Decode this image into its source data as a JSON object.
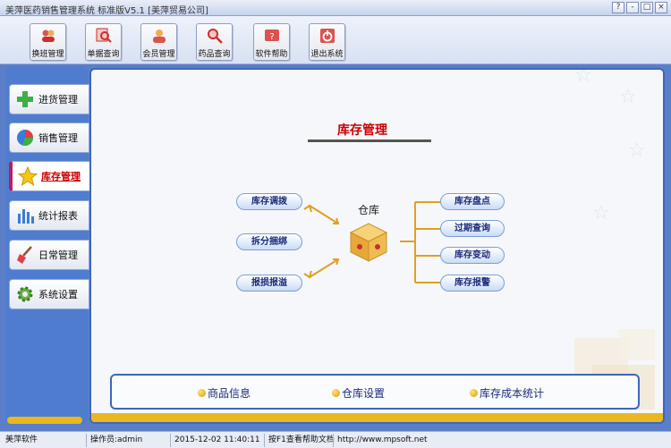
{
  "window": {
    "title": "美萍医药销售管理系统 标准版V5.1 [美萍贸易公司]",
    "controls": [
      "?",
      "-",
      "□",
      "×"
    ]
  },
  "toolbar": {
    "buttons": [
      {
        "label": "换班管理",
        "icon": "users-icon",
        "color": "#d9534f"
      },
      {
        "label": "单据查询",
        "icon": "magnifier-icon",
        "color": "#d9534f"
      },
      {
        "label": "会员管理",
        "icon": "member-icon",
        "color": "#d9534f"
      },
      {
        "label": "药品查询",
        "icon": "search-drug-icon",
        "color": "#d9534f"
      },
      {
        "label": "软件帮助",
        "icon": "help-icon",
        "color": "#d9534f"
      },
      {
        "label": "退出系统",
        "icon": "exit-icon",
        "color": "#d9534f"
      }
    ]
  },
  "nav": {
    "items": [
      {
        "label": "进货管理",
        "icon": "plus-icon"
      },
      {
        "label": "销售管理",
        "icon": "pie-chart-icon"
      },
      {
        "label": "库存管理",
        "icon": "star-icon",
        "active": true
      },
      {
        "label": "统计报表",
        "icon": "bar-chart-icon"
      },
      {
        "label": "日常管理",
        "icon": "broom-icon"
      },
      {
        "label": "系统设置",
        "icon": "gear-icon"
      }
    ]
  },
  "main": {
    "section_title": "库存管理",
    "warehouse_label": "仓库",
    "left_actions": [
      "库存调拨",
      "拆分捆绑",
      "报损报溢"
    ],
    "right_actions": [
      "库存盘点",
      "过期查询",
      "库存变动",
      "库存报警"
    ],
    "bottom_links": [
      "商品信息",
      "仓库设置",
      "库存成本统计"
    ]
  },
  "status": {
    "company": "美萍软件",
    "operator": "操作员:admin",
    "datetime": "2015-12-02 11:40:11",
    "help": "按F1查看帮助文档",
    "url": "http://www.mpsoft.net"
  },
  "colors": {
    "accent": "#3d66c0",
    "title_red": "#cc0000",
    "bar_yellow": "#e9b820",
    "connector_orange": "#e0a020"
  }
}
